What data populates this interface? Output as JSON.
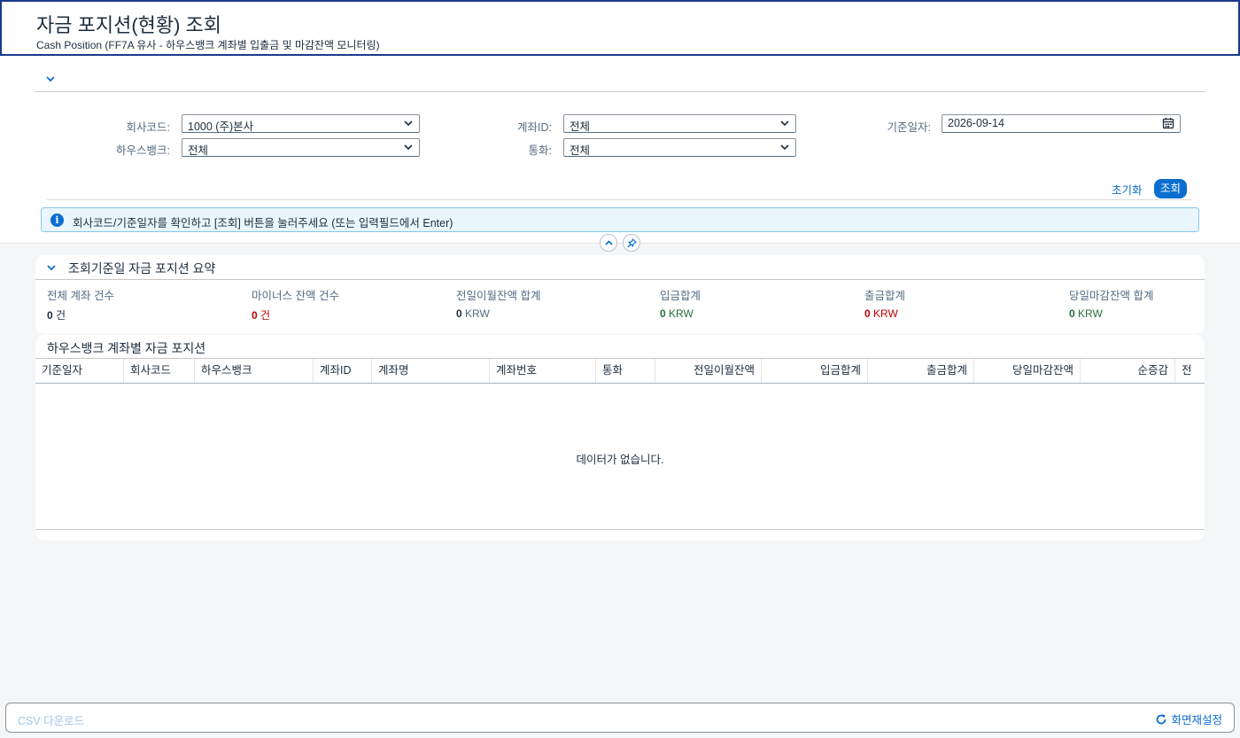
{
  "header": {
    "title": "자금 포지션(현황) 조회",
    "subtitle": "Cash Position (FF7A 유사 - 하우스뱅크 계좌별 입출금 및 마감잔액 모니터링)"
  },
  "filters": {
    "company_code": {
      "label": "회사코드:",
      "value": "1000 (주)본사"
    },
    "account_id": {
      "label": "계좌ID:",
      "value": "전체"
    },
    "base_date": {
      "label": "기준일자:",
      "value": "2026-09-14"
    },
    "house_bank": {
      "label": "하우스뱅크:",
      "value": "전체"
    },
    "currency": {
      "label": "통화:",
      "value": "전체"
    }
  },
  "buttons": {
    "reset": "초기화",
    "search": "조회"
  },
  "message": "회사코드/기준일자를 확인하고 [조회] 버튼을 눌러주세요 (또는 입력필드에서 Enter)",
  "summary": {
    "title": "조회기준일 자금 포지션 요약",
    "kpis": [
      {
        "label": "전체 계좌 건수",
        "value": "0",
        "unit": "건",
        "color": "#1d2d3e",
        "unit_color": "#1d2d3e"
      },
      {
        "label": "마이너스 잔액 건수",
        "value": "0",
        "unit": "건",
        "color": "#bb0000",
        "unit_color": "#bb0000"
      },
      {
        "label": "전일이월잔액 합계",
        "value": "0",
        "unit": "KRW",
        "color": "#1d2d3e",
        "unit_color": "#556b82"
      },
      {
        "label": "입금합계",
        "value": "0",
        "unit": "KRW",
        "color": "#256f3a",
        "unit_color": "#256f3a"
      },
      {
        "label": "출금합계",
        "value": "0",
        "unit": "KRW",
        "color": "#bb0000",
        "unit_color": "#bb0000"
      },
      {
        "label": "당일마감잔액 합계",
        "value": "0",
        "unit": "KRW",
        "color": "#256f3a",
        "unit_color": "#256f3a"
      }
    ]
  },
  "table": {
    "title": "하우스뱅크 계좌별 자금 포지션",
    "columns": [
      "기준일자",
      "회사코드",
      "하우스뱅크",
      "계좌ID",
      "계좌명",
      "계좌번호",
      "통화",
      "전일이월잔액",
      "입금합계",
      "출금합계",
      "당일마감잔액",
      "순증감",
      "전"
    ],
    "no_data": "데이터가 없습니다."
  },
  "footer": {
    "csv": "CSV 다운로드",
    "reset_screen": "화면재설정"
  },
  "colors": {
    "accent": "#0a6ed1",
    "header_border": "#1b3a8c",
    "negative": "#bb0000",
    "positive": "#256f3a"
  },
  "icons": {
    "expand": "chevron-down-icon",
    "info": "info-icon",
    "collapse": "chevron-up-icon",
    "pin": "pin-icon",
    "calendar": "calendar-icon",
    "refresh": "refresh-icon"
  }
}
